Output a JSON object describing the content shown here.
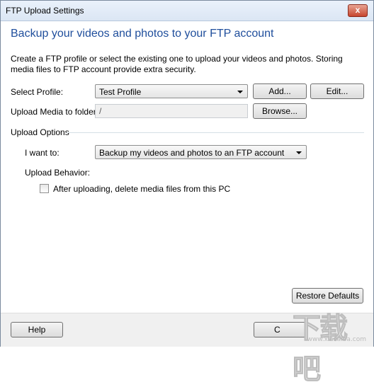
{
  "window": {
    "title": "FTP Upload Settings",
    "close_glyph": "x"
  },
  "heading": "Backup your videos and photos to your FTP account",
  "description": "Create a FTP profile or select the existing one to upload your videos and photos. Storing media files to FTP account provide extra security.",
  "profile": {
    "label": "Select Profile:",
    "selected": "Test Profile",
    "add_button": "Add...",
    "edit_button": "Edit..."
  },
  "upload_folder": {
    "label": "Upload Media to folder:",
    "value": "/",
    "browse_button": "Browse..."
  },
  "upload_options": {
    "section_label": "Upload Options",
    "want_label": "I want to:",
    "want_selected": "Backup my videos and photos to an FTP account",
    "behavior_label": "Upload Behavior:",
    "delete_checkbox_label": "After uploading, delete media files from this PC",
    "delete_checked": false
  },
  "restore_defaults_button": "Restore Defaults",
  "footer": {
    "help_button": "Help",
    "ok_button_partial": "C"
  },
  "watermark": {
    "text": "下载吧",
    "url": "www.xiazaiba.com"
  }
}
